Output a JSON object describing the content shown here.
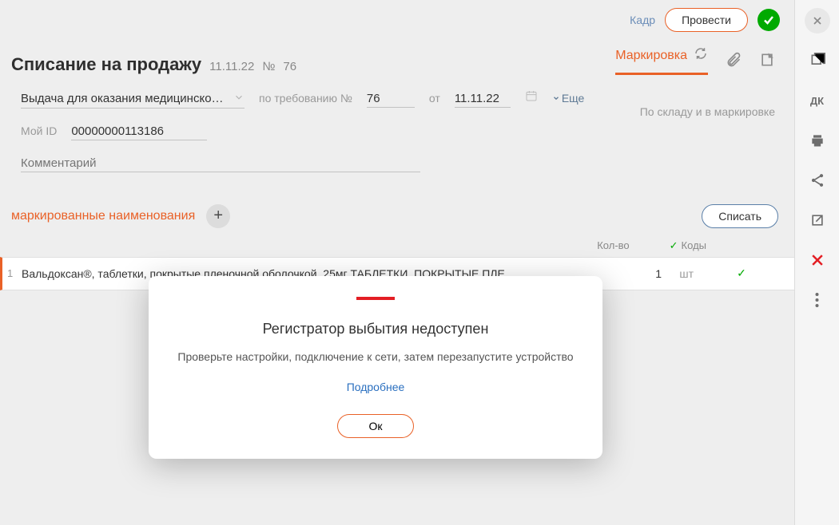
{
  "topbar": {
    "kadr": "Кадр",
    "process": "Провести"
  },
  "title": {
    "main": "Списание на продажу",
    "date": "11.11.22",
    "num_prefix": "№",
    "num": "76"
  },
  "tab": {
    "marking": "Маркировка"
  },
  "form": {
    "reason": "Выдача для оказания медицинской по…",
    "demand_label": "по требованию №",
    "demand_num": "76",
    "from_label": "от",
    "from_date": "11.11.22",
    "more": "Еще",
    "myid_label": "Мой ID",
    "myid": "00000000113186",
    "comment_placeholder": "Комментарий",
    "warehouse_link": "По складу и в маркировке"
  },
  "list": {
    "heading": "маркированные наименования",
    "write_off": "Списать",
    "cols": {
      "qty": "Кол-во",
      "codes": "Коды"
    }
  },
  "row": {
    "idx": "1",
    "name": "Вальдоксан®, таблетки, покрытые пленочной оболочкой, 25мг ТАБЛЕТКИ, ПОКРЫТЫЕ ПЛЕ…",
    "qty": "1",
    "unit": "шт"
  },
  "modal": {
    "title": "Регистратор выбытия недоступен",
    "msg": "Проверьте настройки, подключение к сети, затем перезапустите устройство",
    "more": "Подробнее",
    "ok": "Ок"
  },
  "sidebar": {
    "dk": "ДК"
  }
}
